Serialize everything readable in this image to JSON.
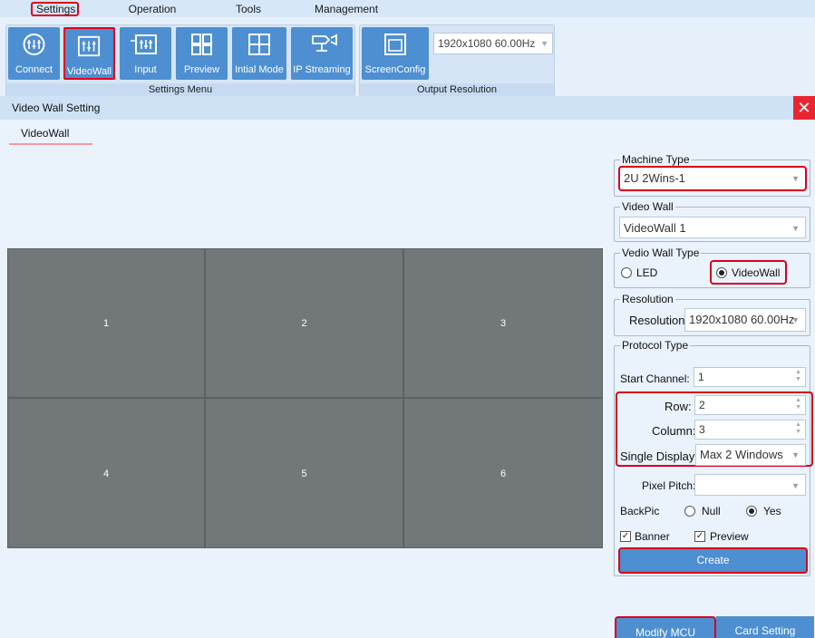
{
  "menu": {
    "tabs": [
      {
        "label": "Settings",
        "active": true
      },
      {
        "label": "Operation"
      },
      {
        "label": "Tools"
      },
      {
        "label": "Management"
      }
    ]
  },
  "ribbon": {
    "settings_menu": {
      "label": "Settings Menu",
      "buttons": [
        {
          "label": "Connect",
          "icon": "connect-icon"
        },
        {
          "label": "VideoWall",
          "icon": "videowall-icon"
        },
        {
          "label": "Input",
          "icon": "input-icon"
        },
        {
          "label": "Preview",
          "icon": "preview-icon"
        },
        {
          "label": "Intial Mode",
          "icon": "grid-icon"
        },
        {
          "label": "IP Streaming",
          "icon": "camera-icon"
        }
      ]
    },
    "output_resolution": {
      "label": "Output Resolution",
      "screen_config_label": "ScreenConfig",
      "resolution_value": "1920x1080 60.00Hz"
    }
  },
  "dialog": {
    "title": "Video Wall Setting",
    "close_icon": "close-icon",
    "tab_label": "VideoWall"
  },
  "wall": {
    "rows": 2,
    "columns": 3,
    "cells": [
      "1",
      "2",
      "3",
      "4",
      "5",
      "6"
    ]
  },
  "panel": {
    "machine_type": {
      "legend": "Machine Type",
      "value": "2U 2Wins-1"
    },
    "video_wall": {
      "legend": "Video Wall",
      "value": "VideoWall 1"
    },
    "wall_type": {
      "legend": "Vedio Wall Type",
      "options": [
        {
          "label": "LED",
          "selected": false
        },
        {
          "label": "VideoWall",
          "selected": true
        }
      ]
    },
    "resolution": {
      "legend": "Resolution",
      "label": "Resolution:",
      "value": "1920x1080 60.00Hz"
    },
    "protocol": {
      "legend": "Protocol Type",
      "start_channel_label": "Start Channel:",
      "start_channel_value": "1",
      "row_label": "Row:",
      "row_value": "2",
      "column_label": "Column:",
      "column_value": "3",
      "single_display_label": "Single Display:",
      "single_display_value": "Max 2 Windows",
      "pixel_pitch_label": "Pixel Pitch:",
      "pixel_pitch_value": "",
      "backpic_label": "BackPic",
      "backpic_options": [
        {
          "label": "Null",
          "selected": false
        },
        {
          "label": "Yes",
          "selected": true
        }
      ],
      "banner_label": "Banner",
      "banner_checked": true,
      "preview_label": "Preview",
      "preview_checked": true,
      "create_label": "Create"
    },
    "modify_mcu_label": "Modify MCU",
    "card_setting_label": "Card Setting"
  },
  "colors": {
    "accent": "#4d8fd1",
    "highlight": "#d6001c",
    "wall_cell": "#727779",
    "close": "#e8262f"
  }
}
